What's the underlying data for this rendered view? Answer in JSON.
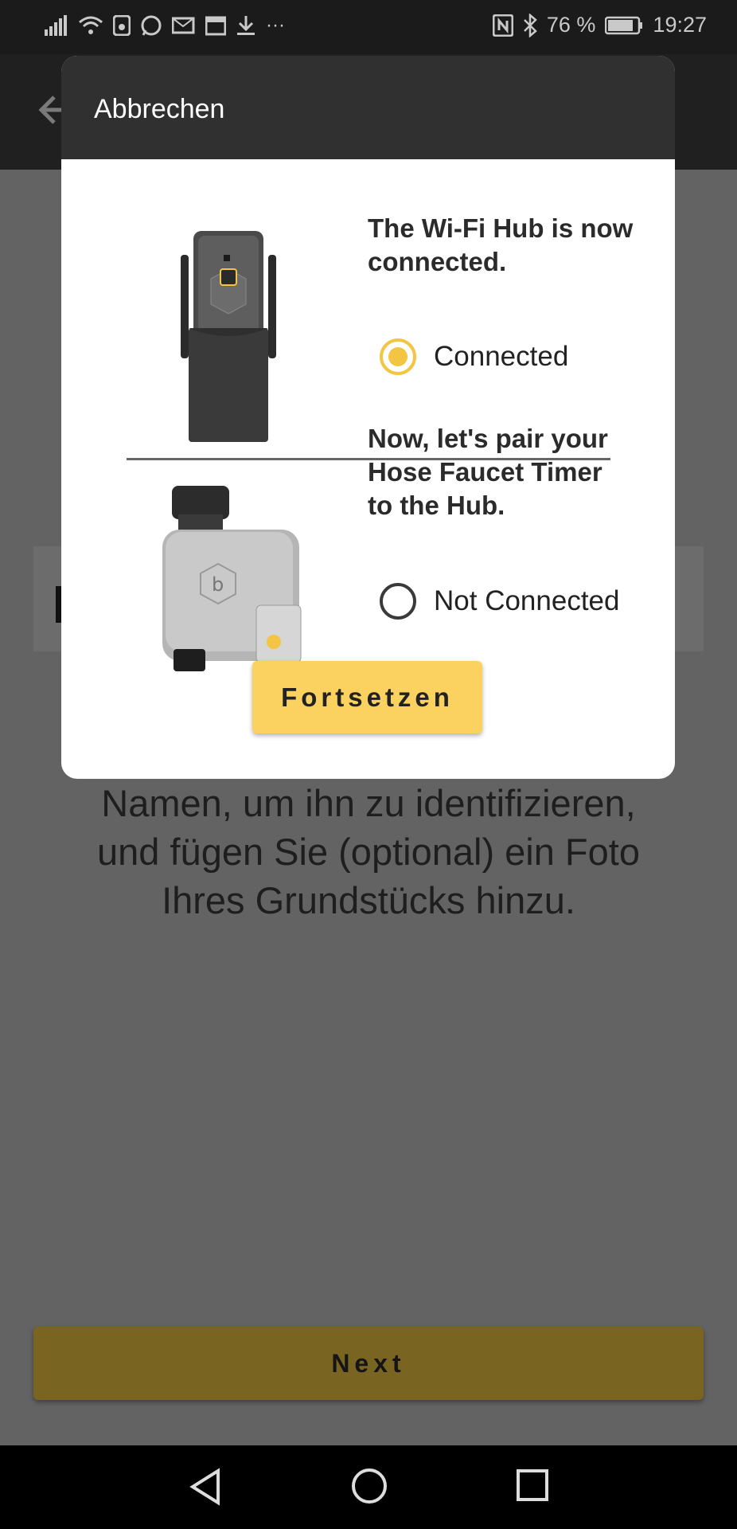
{
  "status_bar": {
    "battery": "76 %",
    "time": "19:27",
    "more": "···"
  },
  "background": {
    "body_text_line1": "Namen, um ihn zu identifizieren,",
    "body_text_line2": "und fügen Sie (optional) ein Foto",
    "body_text_line3": "Ihres Grundstücks hinzu.",
    "next_label": "Next"
  },
  "dialog": {
    "cancel_label": "Abbrechen",
    "hub": {
      "title_line1": "The Wi-Fi Hub is now",
      "title_line2": "connected.",
      "status_label": "Connected",
      "status_selected": true,
      "device_label": "b·hyve"
    },
    "timer": {
      "title_line1": "Now, let's pair your",
      "title_line2": "Hose Faucet Timer",
      "title_line3": "to the Hub.",
      "status_label": "Not Connected",
      "status_selected": false,
      "device_label": "b·hyve"
    },
    "continue_label": "Fortsetzen"
  },
  "colors": {
    "accent": "#fbd260",
    "radio_on": "#f4c542",
    "scrim": "#636363"
  }
}
